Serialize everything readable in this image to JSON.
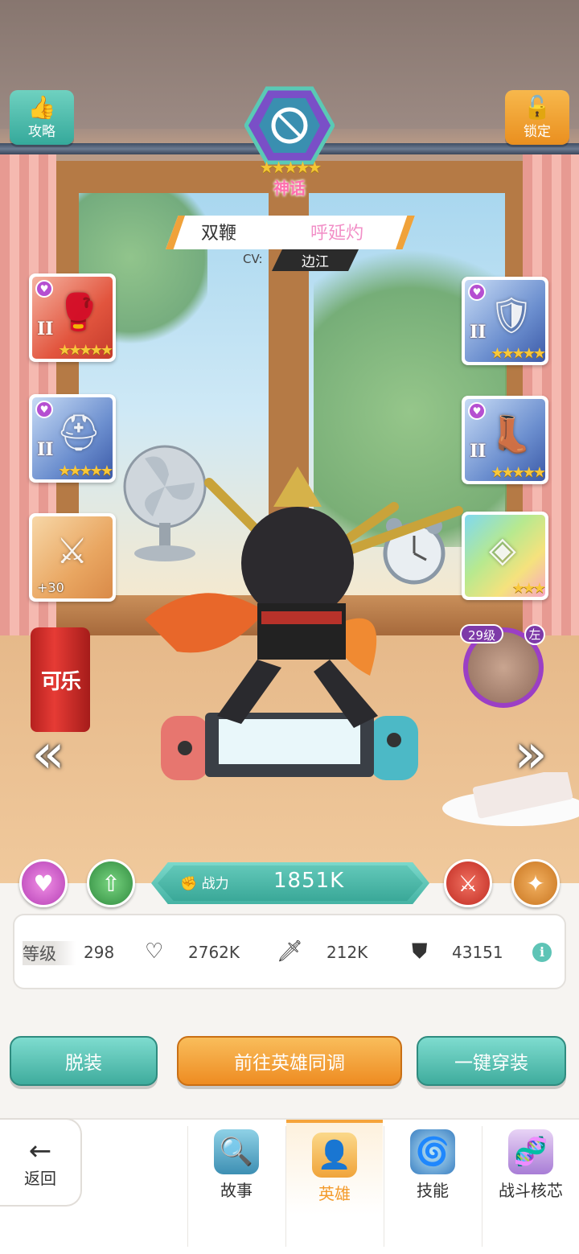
{
  "top": {
    "guide_label": "攻略",
    "lock_label": "锁定",
    "rank_label": "神话",
    "rank_stars": "★★★★★"
  },
  "hero": {
    "title": "双鞭",
    "name": "呼延灼",
    "cv_label": "CV:",
    "cv_name": "边江"
  },
  "equipment": {
    "left": [
      {
        "tier": "II",
        "stars": "★★★★★",
        "glyph": "🥊",
        "color": "red"
      },
      {
        "tier": "II",
        "stars": "★★★★★",
        "glyph": "⛑",
        "color": "blue"
      },
      {
        "plus": "+30",
        "glyph": "⚔",
        "color": "gold"
      }
    ],
    "right": [
      {
        "tier": "II",
        "stars": "★★★★★",
        "glyph": "🛡",
        "color": "blue"
      },
      {
        "tier": "II",
        "stars": "★★★★★",
        "glyph": "👢",
        "color": "blue"
      },
      {
        "stars": "★★★",
        "glyph": "◈",
        "color": "rainbow"
      }
    ]
  },
  "companion": {
    "level": "29级",
    "side": "左"
  },
  "power": {
    "label": "战力",
    "value": "1851K"
  },
  "stats": {
    "level_label": "等级",
    "level": "298",
    "hp": "2762K",
    "attack": "212K",
    "defense": "43151",
    "info": "i"
  },
  "actions": {
    "unequip": "脱装",
    "sync": "前往英雄同调",
    "equip_all": "一键穿装"
  },
  "tabbar": {
    "back": "返回",
    "tabs": [
      {
        "label": "故事",
        "icon": "magnifier-book-icon"
      },
      {
        "label": "英雄",
        "icon": "hero-portrait-icon",
        "active": true
      },
      {
        "label": "技能",
        "icon": "vortex-icon"
      },
      {
        "label": "战斗核芯",
        "icon": "dna-icon"
      }
    ]
  },
  "colors": {
    "accent_teal": "#45b3a4",
    "accent_orange": "#ee8c22",
    "myth_pink": "#ff6fae"
  }
}
